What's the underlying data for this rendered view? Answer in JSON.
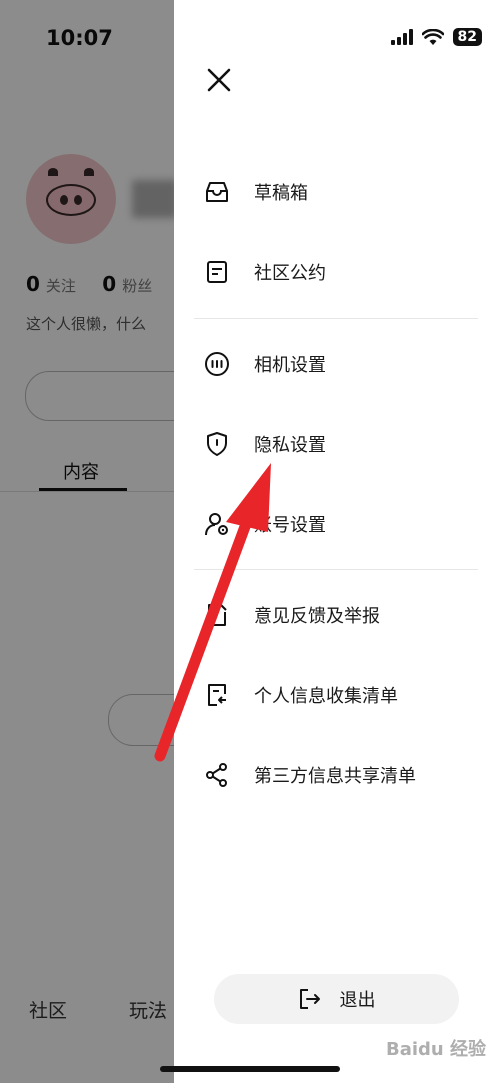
{
  "status": {
    "time": "10:07",
    "battery": "82"
  },
  "background": {
    "stats": [
      {
        "num": "0",
        "label": "关注"
      },
      {
        "num": "0",
        "label": "粉丝"
      }
    ],
    "bio": "这个人很懒，什么",
    "tab": "内容",
    "nav": [
      "社区",
      "玩法"
    ]
  },
  "drawer": {
    "items": [
      {
        "label": "草稿箱",
        "icon": "inbox-icon"
      },
      {
        "label": "社区公约",
        "icon": "document-icon"
      },
      {
        "label": "相机设置",
        "icon": "camera-settings-icon"
      },
      {
        "label": "隐私设置",
        "icon": "shield-icon"
      },
      {
        "label": "账号设置",
        "icon": "account-gear-icon"
      },
      {
        "label": "意见反馈及举报",
        "icon": "feedback-icon"
      },
      {
        "label": "个人信息收集清单",
        "icon": "list-return-icon"
      },
      {
        "label": "第三方信息共享清单",
        "icon": "share-icon"
      }
    ],
    "logout": "退出"
  },
  "watermark": "Baidu 经验",
  "colors": {
    "arrow": "#e8262a",
    "overlay": "#000000"
  }
}
